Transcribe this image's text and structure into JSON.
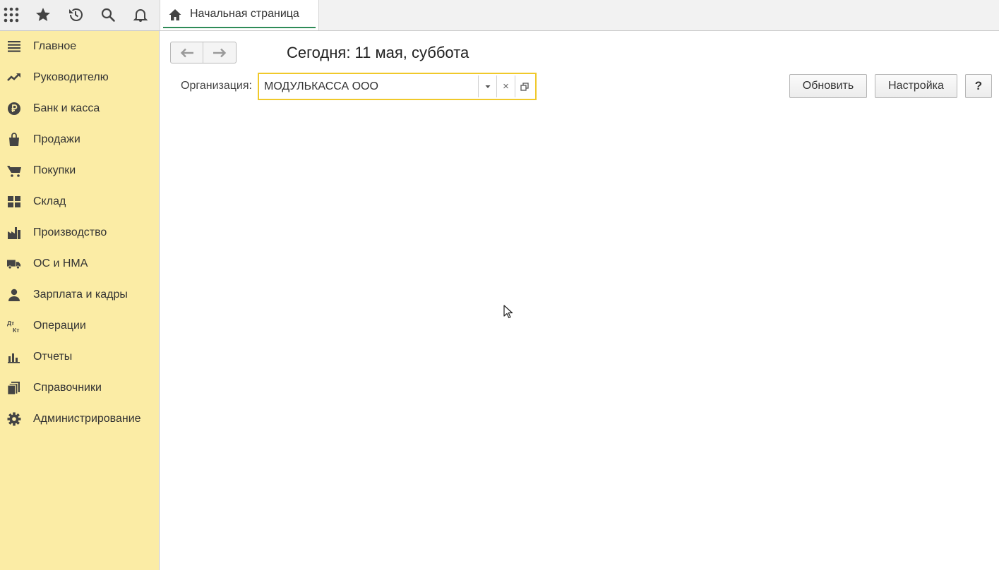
{
  "topbar": {
    "icons": [
      "apps-grid-icon",
      "favorites-star-icon",
      "history-icon",
      "search-icon",
      "notifications-bell-icon"
    ],
    "tab": {
      "label": "Начальная страница",
      "icon": "home-icon"
    }
  },
  "sidebar": {
    "items": [
      {
        "label": "Главное",
        "icon": "menu-lines-icon"
      },
      {
        "label": "Руководителю",
        "icon": "trend-chart-icon"
      },
      {
        "label": "Банк и касса",
        "icon": "ruble-coin-icon"
      },
      {
        "label": "Продажи",
        "icon": "shopping-bag-icon"
      },
      {
        "label": "Покупки",
        "icon": "cart-icon"
      },
      {
        "label": "Склад",
        "icon": "warehouse-grid-icon"
      },
      {
        "label": "Производство",
        "icon": "factory-icon"
      },
      {
        "label": "ОС и НМА",
        "icon": "truck-icon"
      },
      {
        "label": "Зарплата и кадры",
        "icon": "person-icon"
      },
      {
        "label": "Операции",
        "icon": "debit-credit-icon"
      },
      {
        "label": "Отчеты",
        "icon": "bar-chart-icon"
      },
      {
        "label": "Справочники",
        "icon": "books-icon"
      },
      {
        "label": "Администрирование",
        "icon": "gear-icon"
      }
    ],
    "operations_icon_text": {
      "top": "Дт",
      "bottom": "Кт"
    },
    "background": "#fbeca5"
  },
  "main": {
    "title": "Сегодня: 11 мая, суббота",
    "organization": {
      "label": "Организация:",
      "value": "МОДУЛЬКАССА ООО",
      "clear_glyph": "×"
    },
    "buttons": {
      "refresh": "Обновить",
      "settings": "Настройка",
      "help": "?"
    }
  },
  "colors": {
    "accent_underline": "#2e8b57",
    "field_focus_border": "#f0c92a"
  }
}
